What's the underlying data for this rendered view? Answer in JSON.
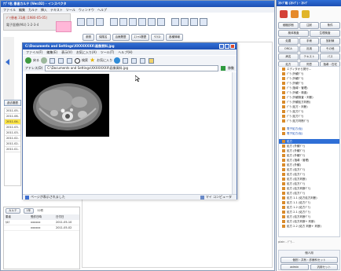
{
  "main_window": {
    "title": "ｱﾌﾟﾘ名 患者カルテ (Ver.02) - インスペクタ",
    "menu": [
      "ファイル",
      "編集",
      "カルテ",
      "挿入",
      "テキスト",
      "ツール",
      "ウィンドウ",
      "ヘルプ"
    ],
    "patient": {
      "name_line": "ﾃﾞﾓ患者 31歳 (1980-05-05)",
      "id_line": "電子医療(MU) 1-2-3-4"
    },
    "toolbar_tabs": [
      "参照",
      "保険名",
      "治療履歴",
      "ｽﾌｧｲﾙ履歴",
      "ｻﾏﾘｽﾄ",
      "各種情報"
    ],
    "history_button": "過去履歴",
    "dates": [
      "2011-05-",
      "2011-06-",
      "2011-04-",
      "2011-03-",
      "2011-03-",
      "2011-02-",
      "2011-02-",
      "2011-01-"
    ],
    "footer": {
      "karte_label": "カルテ",
      "count_label": "1年",
      "months_label": "12件",
      "columns": [
        "患者",
        "受診日時",
        "日付日"
      ],
      "rows": [
        [
          "ｶﾙﾃ",
          "xxxxxx",
          "2011-05-10"
        ],
        [
          "",
          "xxxxxx",
          "2011-05-02"
        ]
      ]
    }
  },
  "viewer_window": {
    "title": "C:\\Documents and Settings\\XXXXXXXX\\画像資料.jpg",
    "menu": [
      "ファイル(F)",
      "編集(E)",
      "表示(V)",
      "お気に入り(A)",
      "ツール(T)",
      "ヘルプ(H)"
    ],
    "toolbar": {
      "back_label": "戻る",
      "search_label": "検索",
      "favorites_label": "お気に入り"
    },
    "address_label": "アドレス(D)",
    "address_value": "C:\\Documents and Settings\\XXXXXXXX\\画像資料.jpg",
    "go_label": "移動",
    "status_left": "ページが表示されました",
    "status_right": "マイ コンピュータ"
  },
  "stamp_panel": {
    "title": "ｽﾀﾝﾌﾟ箱 (ｽﾀﾝﾌﾟ) - ｽﾀﾝﾌﾟ",
    "tabs_row1": [
      "細胞診断",
      "注射",
      "条件"
    ],
    "tabs_row2": [
      "検体検査",
      "生理検査"
    ],
    "tabs_row3": [
      "処置",
      "手術",
      "放射線"
    ],
    "tabs_row4": [
      "ORCA",
      "汎用",
      "その他"
    ],
    "tabs_row5": [
      "病名",
      "テキスト",
      "パス"
    ],
    "tabs_row6": [
      "処方",
      "同意",
      "指導・在宅"
    ],
    "tree_group1": [
      "エディタから発行...",
      "ﾃﾞﾓ (外観ﾃﾞﾓ)",
      "ﾃﾞﾓ (外観ﾃﾞﾓ)",
      "ﾃﾞﾓ (外観ﾃﾞﾓ)",
      "ﾃﾞﾓ (指導・管理)",
      "ﾃﾞﾓ (外観・検査)",
      "ﾃﾞﾓ (外観検査・判断)",
      "ﾃﾞﾓ (外観処方判断)",
      "ﾃﾞﾓ (処方・判断)",
      "ﾃﾞﾓ (処方ﾃﾞﾓ)",
      "ﾃﾞﾓ (処方ﾃﾞﾓ)",
      "ﾃﾞﾓ (処方判断ﾃﾞﾓ)"
    ],
    "tree_mid": [
      "電子処方(仮)",
      "電子処方(仮)"
    ],
    "tree_selected": "処方",
    "tree_group2": [
      "処方 (外観ﾃﾞﾓ)",
      "処方 (外観ﾃﾞﾓ)",
      "処方 (外観ﾃﾞﾓ)",
      "処方 (指導・管理)",
      "処方 (外観)",
      "処方 (処方ﾃﾞﾓ)",
      "処方 (処方ﾃﾞﾓ)",
      "処方 (処方判断)",
      "処方 (処方ﾃﾞﾓ)",
      "処方 (処方判断ﾃﾞﾓ)",
      "処方 (処方ﾃﾞﾓ)",
      "処方 1-1 (処方処方判断)",
      "処方 1-1 (処方ﾃﾞﾓ)",
      "処方 1-2 (処方ﾃﾞﾓ)",
      "処方 2-1 (処方ﾃﾞﾓ)",
      "処方 (処方判断ﾃﾞﾓ)",
      "処方 (処方判断+ 判断)",
      "処方 2-2 (処方 判断+ 判断)"
    ],
    "status_text": "plain - ﾃﾞﾓ...",
    "bottom_title": "個人用",
    "bottom_row1": [
      "個別・共有・診療科セット"
    ],
    "bottom_row2": [
      "admin",
      "汎用セット"
    ]
  }
}
